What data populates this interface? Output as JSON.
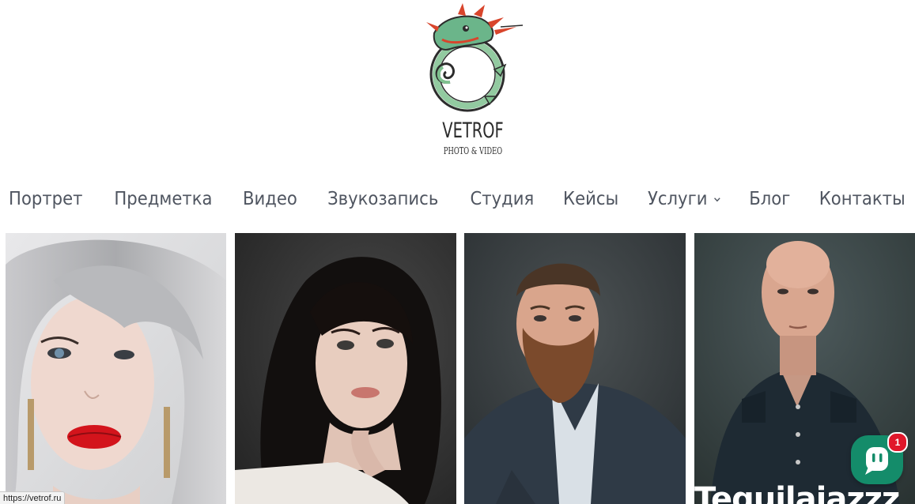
{
  "brand": {
    "name": "VETROF",
    "tagline": "PHOTO & VIDEO"
  },
  "nav": {
    "items": [
      {
        "label": "Портрет"
      },
      {
        "label": "Предметка"
      },
      {
        "label": "Видео"
      },
      {
        "label": "Звукозапись"
      },
      {
        "label": "Студия"
      },
      {
        "label": "Кейсы"
      },
      {
        "label": "Услуги",
        "has_dropdown": true
      },
      {
        "label": "Блог"
      },
      {
        "label": "Контакты"
      }
    ]
  },
  "gallery": {
    "tiles": [
      {
        "subject": "woman-silver-hair"
      },
      {
        "subject": "woman-dark-hair"
      },
      {
        "subject": "bearded-man-blazer"
      },
      {
        "subject": "bald-man-shirt"
      }
    ],
    "overlay_text": "Tequilajazzz"
  },
  "status_bar": {
    "url": "https://vetrof.ru"
  },
  "chat_widget": {
    "badge_count": "1",
    "icon": "chat-bubble-icon",
    "color": "#148c6a",
    "badge_color": "#e1172b"
  },
  "colors": {
    "nav_text": "#4f5560",
    "background": "#ffffff"
  }
}
